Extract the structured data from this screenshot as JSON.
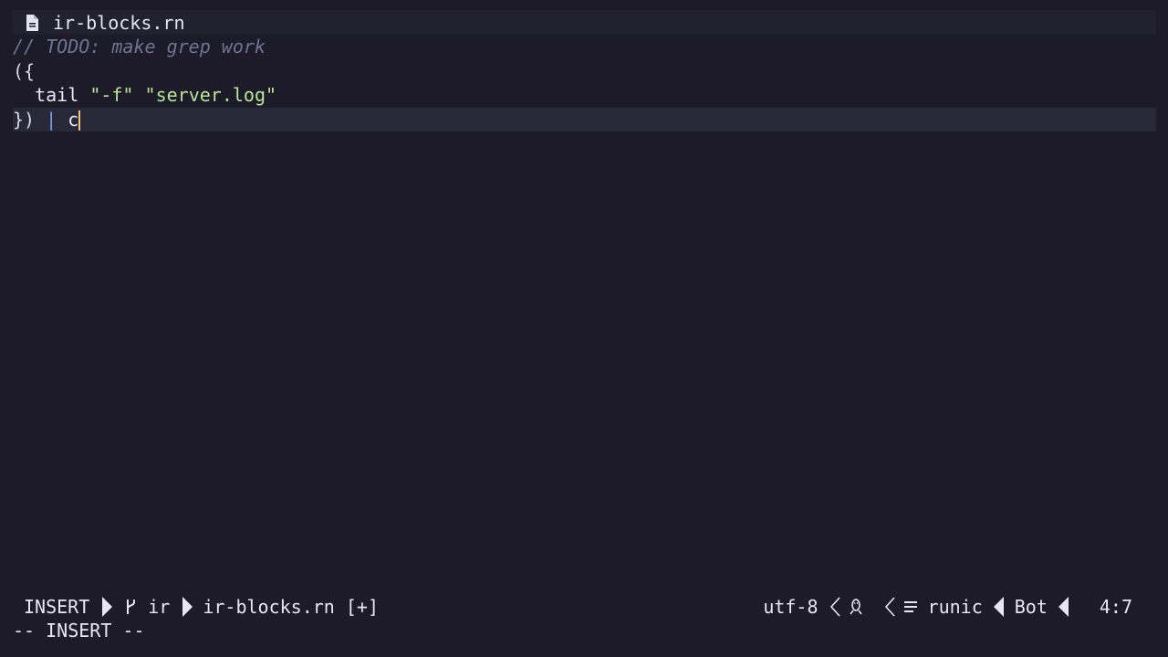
{
  "tabline": {
    "file_icon": "file-icon",
    "filename": "ir-blocks.rn"
  },
  "editor": {
    "lines": {
      "l1_comment": "// TODO: make grep work",
      "l2_open": "({",
      "l3_indent": "  ",
      "l3_cmd": "tail",
      "l3_arg1": "\"-f\"",
      "l3_arg2": "\"server.log\"",
      "l4_close": "})",
      "l4_pipe": "|",
      "l4_typed": "c"
    }
  },
  "statusline": {
    "mode": "INSERT",
    "branch_icon": "git-branch-icon",
    "branch": "ir",
    "file": "ir-blocks.rn [+]",
    "encoding": "utf-8",
    "os_icon": "linux-tux-icon",
    "filetype_icon": "list-icon",
    "filetype": "runic",
    "scroll": "Bot",
    "position": "4:7"
  },
  "cmdline": {
    "text": "-- INSERT --"
  },
  "colors": {
    "background": "#1c1b27",
    "comment": "#6f7395",
    "string": "#b7e49a",
    "pipe": "#7aa0e8",
    "cursor": "#f0c67a"
  }
}
